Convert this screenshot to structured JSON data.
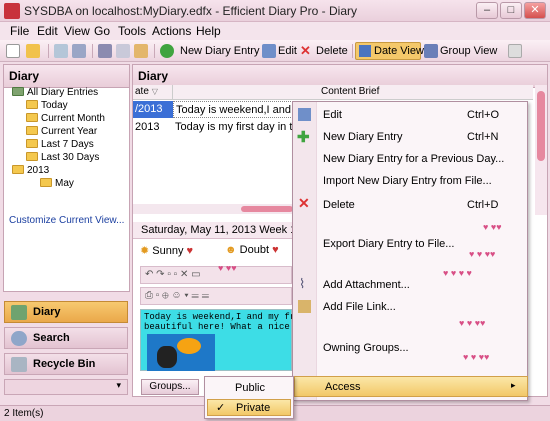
{
  "window": {
    "title": "SYSDBA on localhost:MyDiary.edfx - Efficient Diary Pro - Diary",
    "min": "–",
    "max": "□",
    "close": "✕"
  },
  "menu": [
    "File",
    "Edit",
    "View",
    "Go",
    "Tools",
    "Actions",
    "Help"
  ],
  "toolbar": {
    "new_entry": "New Diary Entry",
    "edit": "Edit",
    "delete": "Delete",
    "date_view": "Date View",
    "group_view": "Group View"
  },
  "left": {
    "header": "Diary",
    "tree": [
      "All Diary Entries",
      "Today",
      "Current Month",
      "Current Year",
      "Last 7 Days",
      "Last 30 Days",
      "2013",
      "May"
    ],
    "customize": "Customize Current View...",
    "nav": [
      "Diary",
      "Search",
      "Recycle Bin"
    ]
  },
  "main": {
    "header": "Diary",
    "col_date": "ate",
    "col_brief": "Content Brief",
    "rows": [
      {
        "date": "/2013",
        "brief": "Today is weekend,I and m"
      },
      {
        "date": "2013",
        "brief": "Today is my first day in th"
      }
    ],
    "date_header": "Saturday, May 11, 2013  Week 1",
    "weather": "Sunny",
    "mood": "Doubt",
    "editor_text": "Today is weekend,I and my frien\nbeautiful here! What a nice day",
    "groups_btn": "Groups..."
  },
  "context_menu": {
    "items": [
      {
        "label": "Edit",
        "shortcut": "Ctrl+O"
      },
      {
        "label": "New Diary Entry",
        "shortcut": "Ctrl+N"
      },
      {
        "label": "New Diary Entry for a Previous Day...",
        "shortcut": ""
      },
      {
        "label": "Import New Diary Entry from File...",
        "shortcut": ""
      },
      {
        "label": "Delete",
        "shortcut": "Ctrl+D"
      },
      {
        "label": "Export Diary Entry to File...",
        "shortcut": ""
      },
      {
        "label": "Add Attachment...",
        "shortcut": ""
      },
      {
        "label": "Add File Link...",
        "shortcut": ""
      },
      {
        "label": "Owning Groups...",
        "shortcut": ""
      },
      {
        "label": "Access",
        "shortcut": ""
      }
    ],
    "submenu": [
      {
        "label": "Public",
        "checked": ""
      },
      {
        "label": "Private",
        "checked": "✓"
      }
    ]
  },
  "status": "2 Item(s)",
  "colors": {
    "accent": "#f4c86a",
    "selected": "#3b6fd6",
    "heart": "#d84f86"
  }
}
